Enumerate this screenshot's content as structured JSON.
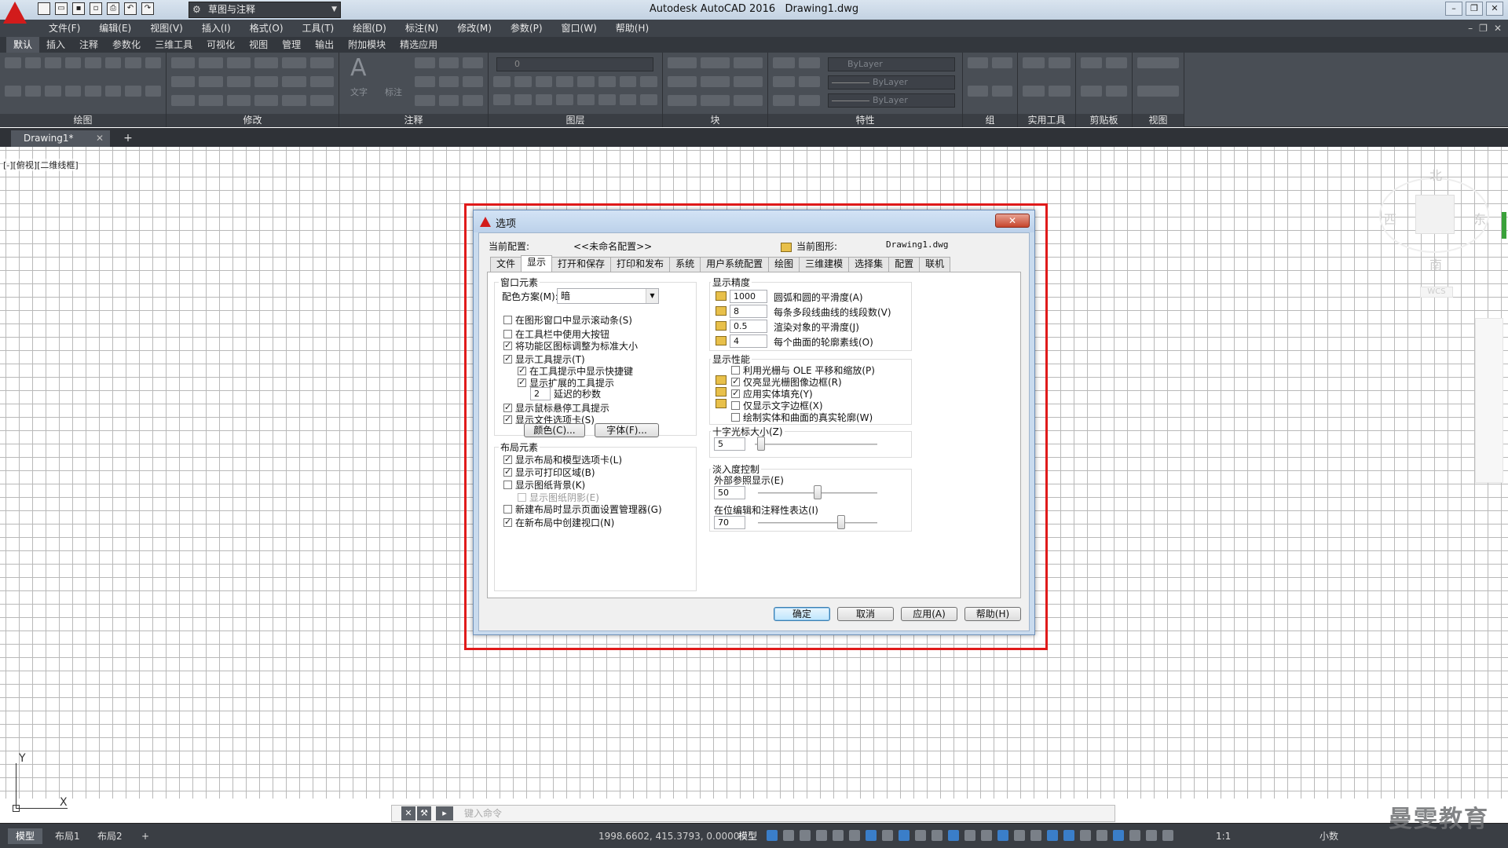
{
  "app": {
    "window_title": "Autodesk AutoCAD 2016",
    "document_name": "Drawing1.dwg",
    "workspace": "草图与注释"
  },
  "menu": [
    "文件(F)",
    "编辑(E)",
    "视图(V)",
    "插入(I)",
    "格式(O)",
    "工具(T)",
    "绘图(D)",
    "标注(N)",
    "修改(M)",
    "参数(P)",
    "窗口(W)",
    "帮助(H)"
  ],
  "ribbon_tabs": [
    "默认",
    "插入",
    "注释",
    "参数化",
    "三维工具",
    "可视化",
    "视图",
    "管理",
    "输出",
    "附加模块",
    "精选应用"
  ],
  "ribbon_panels": {
    "draw": "绘图",
    "modify": "修改",
    "annotation": "注释",
    "layers": "图层",
    "block": "块",
    "properties": "特性",
    "groups": "组",
    "utilities": "实用工具",
    "clipboard": "剪贴板",
    "view": "视图"
  },
  "ribbon_small": {
    "text": "文字",
    "dimension": "标注",
    "layer_value": "0",
    "bylayer": "ByLayer"
  },
  "doc_tab": "Drawing1*",
  "viewport_label": "[-][俯视][二维线框]",
  "viewcube": {
    "north": "北",
    "south": "南",
    "east": "东",
    "west": "西",
    "wcs": "WCS"
  },
  "ucs": {
    "x": "X",
    "y": "Y"
  },
  "command_placeholder": "键入命令",
  "status": {
    "tabs": [
      "模型",
      "布局1",
      "布局2"
    ],
    "coords": "1998.6602, 415.3793, 0.0000",
    "model": "模型",
    "scale": "1:1",
    "units": "小数"
  },
  "watermark": "曼雯教育",
  "dialog": {
    "title": "选项",
    "close": "✕",
    "current_profile_label": "当前配置:",
    "current_profile_value": "<<未命名配置>>",
    "current_drawing_label": "当前图形:",
    "current_drawing_value": "Drawing1.dwg",
    "tabs": [
      "文件",
      "显示",
      "打开和保存",
      "打印和发布",
      "系统",
      "用户系统配置",
      "绘图",
      "三维建模",
      "选择集",
      "配置",
      "联机"
    ],
    "window_elements": {
      "title": "窗口元素",
      "color_scheme_label": "配色方案(M):",
      "color_scheme_value": "暗",
      "scrollbars": "在图形窗口中显示滚动条(S)",
      "large_buttons": "在工具栏中使用大按钮",
      "resize_ribbon_icons": "将功能区图标调整为标准大小",
      "show_tooltips": "显示工具提示(T)",
      "shortcut_in_tooltips": "在工具提示中显示快捷键",
      "extended_tooltips": "显示扩展的工具提示",
      "delay_value": "2",
      "delay_label": "延迟的秒数",
      "rollover_tooltips": "显示鼠标悬停工具提示",
      "file_tabs": "显示文件选项卡(S)",
      "colors_button": "颜色(C)...",
      "fonts_button": "字体(F)..."
    },
    "layout_elements": {
      "title": "布局元素",
      "layout_model_tabs": "显示布局和模型选项卡(L)",
      "printable_area": "显示可打印区域(B)",
      "paper_background": "显示图纸背景(K)",
      "paper_shadow": "显示图纸阴影(E)",
      "page_setup_manager": "新建布局时显示页面设置管理器(G)",
      "create_viewport": "在新布局中创建视口(N)"
    },
    "display_resolution": {
      "title": "显示精度",
      "arc_smoothness_value": "1000",
      "arc_smoothness_label": "圆弧和圆的平滑度(A)",
      "polyline_segments_value": "8",
      "polyline_segments_label": "每条多段线曲线的线段数(V)",
      "rendered_smoothness_value": "0.5",
      "rendered_smoothness_label": "渲染对象的平滑度(J)",
      "contour_lines_value": "4",
      "contour_lines_label": "每个曲面的轮廓素线(O)"
    },
    "display_performance": {
      "title": "显示性能",
      "pan_zoom_raster": "利用光栅与 OLE 平移和缩放(P)",
      "highlight_raster_frame": "仅亮显光栅图像边框(R)",
      "solid_fill": "应用实体填充(Y)",
      "text_boundary": "仅显示文字边框(X)",
      "true_silhouettes": "绘制实体和曲面的真实轮廓(W)"
    },
    "crosshair": {
      "title": "十字光标大小(Z)",
      "value": "5",
      "level": 0.05
    },
    "fade_control": {
      "title": "淡入度控制",
      "xref_label": "外部参照显示(E)",
      "xref_value": "50",
      "xref_level": 0.5,
      "inplace_label": "在位编辑和注释性表达(I)",
      "inplace_value": "70",
      "inplace_level": 0.7
    },
    "buttons": {
      "ok": "确定",
      "cancel": "取消",
      "apply": "应用(A)",
      "help": "帮助(H)"
    }
  }
}
